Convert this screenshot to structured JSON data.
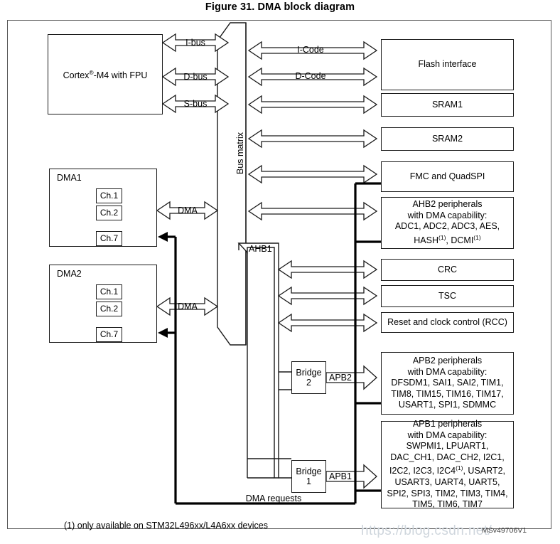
{
  "figure": {
    "title": "Figure 31. DMA block diagram",
    "ref_code": "MSv49706V1",
    "watermark": "https://blog.csdn.net/",
    "footnote": "(1) only available on STM32L496xx/L4A6xx devices"
  },
  "core": {
    "label_html": "Cortex<sup>®</sup>-M4 with FPU",
    "buses": [
      "I-bus",
      "D-bus",
      "S-bus"
    ]
  },
  "bus_matrix": {
    "label": "Bus matrix",
    "code_buses": [
      "I-Code",
      "D-Code"
    ]
  },
  "ahb1": {
    "label": "AHB1"
  },
  "dma": [
    {
      "name": "DMA1",
      "channels": [
        "Ch.1",
        "Ch.2",
        "Ch.7"
      ],
      "ellipsis": "⋮",
      "port_label": "DMA"
    },
    {
      "name": "DMA2",
      "channels": [
        "Ch.1",
        "Ch.2",
        "Ch.7"
      ],
      "ellipsis": "⋮",
      "port_label": "DMA"
    }
  ],
  "dma_requests": {
    "label": "DMA requests"
  },
  "bridges": [
    {
      "name_line1": "Bridge",
      "name_line2": "2",
      "bus_label": "APB2"
    },
    {
      "name_line1": "Bridge",
      "name_line2": "1",
      "bus_label": "APB1"
    }
  ],
  "blocks": [
    {
      "id": "flash",
      "lines": [
        "Flash interface"
      ]
    },
    {
      "id": "sram1",
      "lines": [
        "SRAM1"
      ]
    },
    {
      "id": "sram2",
      "lines": [
        "SRAM2"
      ]
    },
    {
      "id": "fmc",
      "lines": [
        "FMC and QuadSPI"
      ]
    },
    {
      "id": "ahb2",
      "lines": [
        "AHB2 peripherals",
        "with DMA capability:",
        "ADC1, ADC2, ADC3, AES,",
        "HASH(1), DCMI(1)"
      ]
    },
    {
      "id": "crc",
      "lines": [
        "CRC"
      ]
    },
    {
      "id": "tsc",
      "lines": [
        "TSC"
      ]
    },
    {
      "id": "rcc",
      "lines": [
        "Reset and clock control (RCC)"
      ]
    },
    {
      "id": "apb2",
      "lines": [
        "APB2 peripherals",
        "with DMA capability:",
        "DFSDM1, SAI1, SAI2, TIM1,",
        "TIM8, TIM15, TIM16, TIM17,",
        "USART1, SPI1, SDMMC"
      ]
    },
    {
      "id": "apb1",
      "lines": [
        "APB1 peripherals",
        "with DMA capability:",
        "SWPMI1, LPUART1,",
        "DAC_CH1, DAC_CH2, I2C1,",
        "I2C2, I2C3, I2C4(1), USART2,",
        "USART3, UART4, UART5,",
        "SPI2, SPI3, TIM2, TIM3, TIM4,",
        "TIM5, TIM6, TIM7"
      ]
    }
  ],
  "colors": {
    "stroke": "#1a1a1a",
    "frame": "#555555",
    "thick": "#000000",
    "watermark": "#cfd6dd"
  }
}
